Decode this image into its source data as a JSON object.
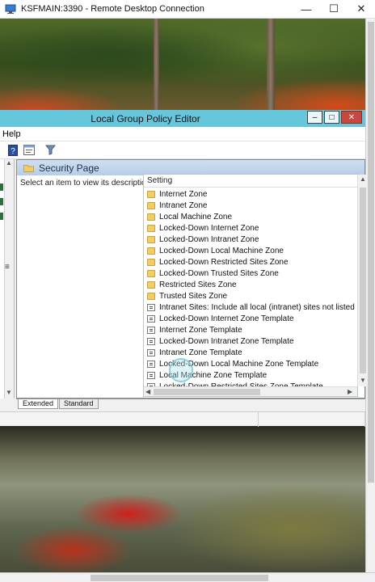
{
  "rdp": {
    "title": "KSFMAIN:3390 - Remote Desktop Connection",
    "icon": "remote-desktop-icon",
    "controls": {
      "minimize": "—",
      "maximize": "☐",
      "close": "✕"
    }
  },
  "gpe": {
    "title": "Local Group Policy Editor",
    "controls": {
      "minimize": "–",
      "maximize": "□",
      "close": "✕"
    },
    "menu": [
      "Help"
    ],
    "toolbar": [
      "help-icon",
      "properties-icon",
      "filter-icon"
    ],
    "header_title": "Security Page",
    "description": "Select an item to view its description.",
    "settings_column": "Setting",
    "settings": [
      {
        "label": "Internet Zone",
        "type": "folder"
      },
      {
        "label": "Intranet Zone",
        "type": "folder"
      },
      {
        "label": "Local Machine Zone",
        "type": "folder"
      },
      {
        "label": "Locked-Down Internet Zone",
        "type": "folder"
      },
      {
        "label": "Locked-Down Intranet Zone",
        "type": "folder"
      },
      {
        "label": "Locked-Down Local Machine Zone",
        "type": "folder"
      },
      {
        "label": "Locked-Down Restricted Sites Zone",
        "type": "folder"
      },
      {
        "label": "Locked-Down Trusted Sites Zone",
        "type": "folder"
      },
      {
        "label": "Restricted Sites Zone",
        "type": "folder"
      },
      {
        "label": "Trusted Sites Zone",
        "type": "folder"
      },
      {
        "label": "Intranet Sites: Include all local (intranet) sites not listed in ot...",
        "type": "setting"
      },
      {
        "label": "Locked-Down Internet Zone Template",
        "type": "setting"
      },
      {
        "label": "Internet Zone Template",
        "type": "setting"
      },
      {
        "label": "Locked-Down Intranet Zone Template",
        "type": "setting"
      },
      {
        "label": "Intranet Zone Template",
        "type": "setting"
      },
      {
        "label": "Locked-Down Local Machine Zone Template",
        "type": "setting"
      },
      {
        "label": "Local Machine Zone Template",
        "type": "setting"
      },
      {
        "label": "Locked-Down Restricted Sites Zone Template",
        "type": "setting"
      }
    ],
    "tabs": [
      {
        "label": "Extended",
        "active": true
      },
      {
        "label": "Standard",
        "active": false
      }
    ]
  },
  "colors": {
    "gpe_titlebar": "#66c6dc",
    "folder": "#f2cd63",
    "header_gradient": "#b7cde6"
  }
}
